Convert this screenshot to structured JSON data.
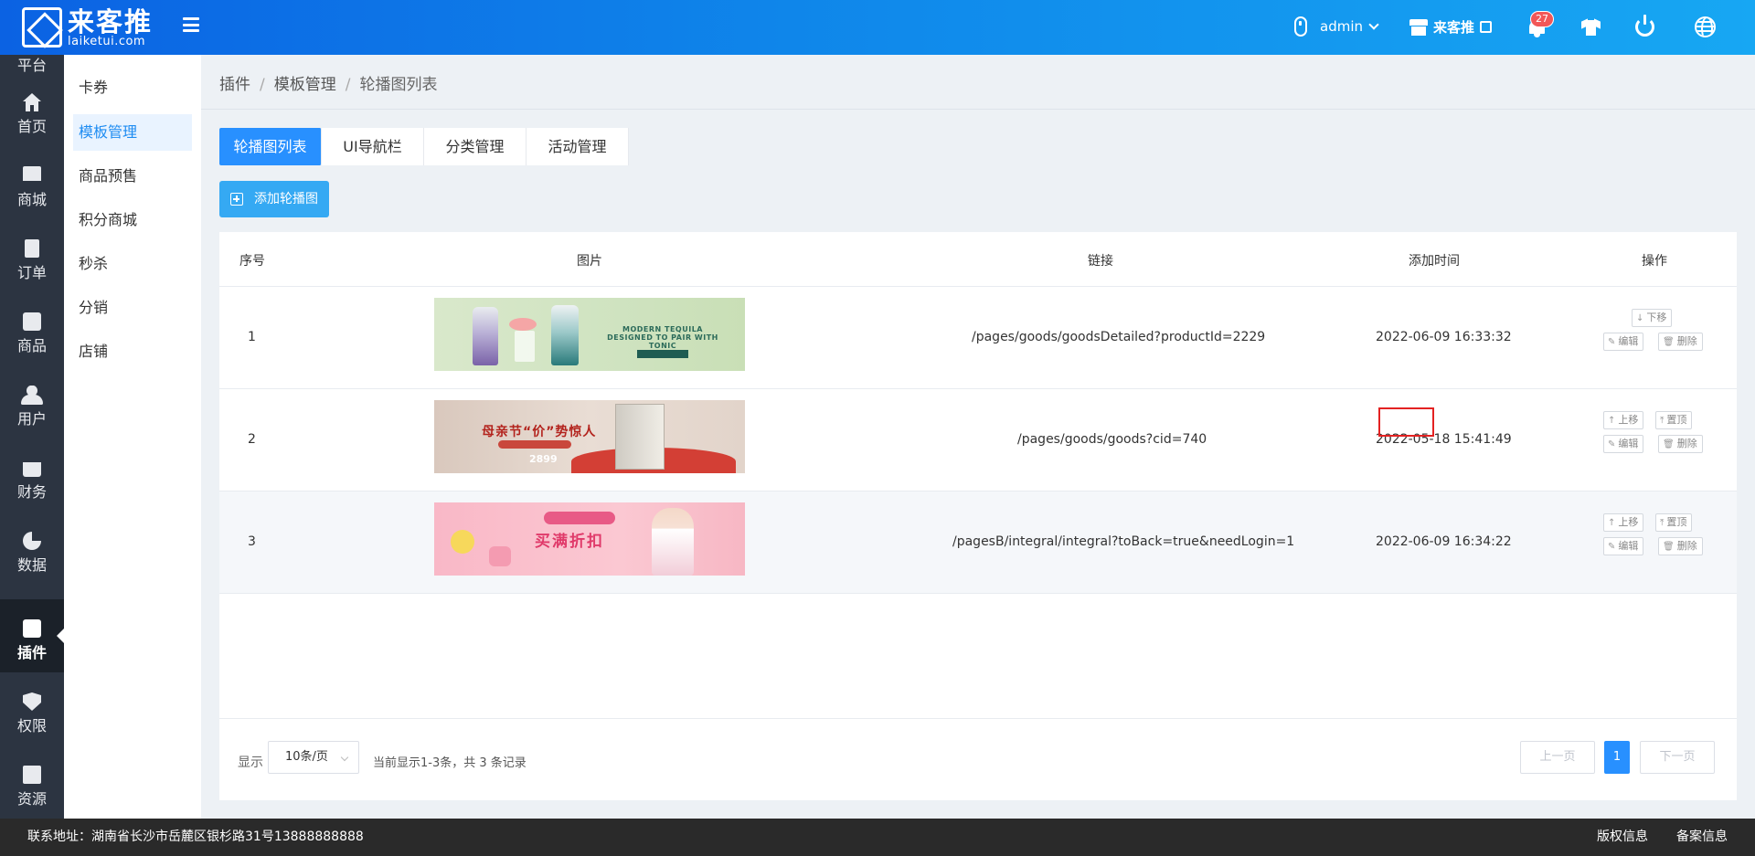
{
  "header": {
    "logo_cn": "来客推",
    "logo_en": "laiketui.com",
    "username": "admin",
    "store_label": "来客推",
    "notification_count": "27"
  },
  "nav": {
    "partial_label": "平台",
    "items": [
      {
        "label": "首页",
        "icon": "home-icon"
      },
      {
        "label": "商城",
        "icon": "mall-icon"
      },
      {
        "label": "订单",
        "icon": "order-icon"
      },
      {
        "label": "商品",
        "icon": "goods-icon"
      },
      {
        "label": "用户",
        "icon": "user-icon"
      },
      {
        "label": "财务",
        "icon": "wallet-icon"
      },
      {
        "label": "数据",
        "icon": "pie-chart-icon"
      },
      {
        "label": "插件",
        "icon": "puzzle-icon"
      },
      {
        "label": "权限",
        "icon": "shield-icon"
      },
      {
        "label": "资源",
        "icon": "image-icon"
      }
    ],
    "active": "插件"
  },
  "subnav": {
    "items": [
      "卡券",
      "模板管理",
      "商品预售",
      "积分商城",
      "秒杀",
      "分销",
      "店铺"
    ],
    "active": "模板管理"
  },
  "breadcrumb": [
    "插件",
    "模板管理",
    "轮播图列表"
  ],
  "tabs": [
    "轮播图列表",
    "UI导航栏",
    "分类管理",
    "活动管理"
  ],
  "add_button_label": "添加轮播图",
  "table": {
    "headers": [
      "序号",
      "图片",
      "链接",
      "添加时间",
      "操作"
    ],
    "rows": [
      {
        "index": "1",
        "link": "/pages/goods/goodsDetailed?productId=2229",
        "time": "2022-06-09 16:33:32",
        "banner_text": "MODERN TEQUILA DESIGNED TO PAIR WITH TONIC"
      },
      {
        "index": "2",
        "link": "/pages/goods/goods?cid=740",
        "time": "2022-05-18 15:41:49",
        "banner_text": "母亲节“价”势惊人",
        "banner_price": "2899"
      },
      {
        "index": "3",
        "link": "/pagesB/integral/integral?toBack=true&needLogin=1",
        "time": "2022-06-09 16:34:22",
        "banner_text": "买满折扣"
      }
    ],
    "actions": {
      "down": "下移",
      "up": "上移",
      "top": "置顶",
      "edit": "编辑",
      "delete": "删除"
    }
  },
  "pagination": {
    "show_label": "显示",
    "page_size": "10条/页",
    "info": "当前显示1-3条，共 3 条记录",
    "prev": "上一页",
    "current": "1",
    "next": "下一页"
  },
  "footer": {
    "address": "联系地址：湖南省长沙市岳麓区银杉路31号13888888888",
    "copyright": "版权信息",
    "record": "备案信息"
  },
  "colors": {
    "primary": "#2890ff",
    "nav_bg": "#2c3441",
    "header_gradient_start": "#0b62e3",
    "header_gradient_end": "#17a7f3",
    "highlight": "#e32222"
  }
}
